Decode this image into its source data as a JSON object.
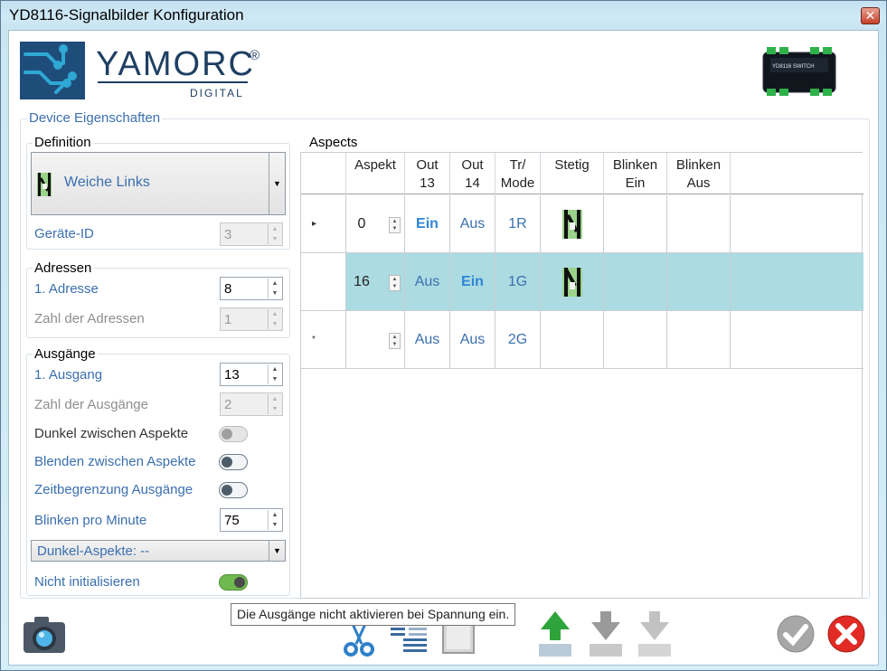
{
  "window": {
    "title": "YD8116-Signalbilder Konfiguration",
    "close_glyph": "✕"
  },
  "logo": {
    "brand": "YAMORC",
    "reg": "®",
    "sub": "DIGITAL",
    "device_label": "YD8116 SWITCH"
  },
  "device_props": {
    "group_label": "Device Eigenschaften",
    "definition": {
      "label": "Definition",
      "selected": "Weiche Links",
      "geraete_id_label": "Geräte-ID",
      "geraete_id_value": "3"
    },
    "adressen": {
      "label": "Adressen",
      "erste_adresse_label": "1. Adresse",
      "erste_adresse_value": "8",
      "zahl_label": "Zahl der Adressen",
      "zahl_value": "1"
    },
    "ausgaenge": {
      "label": "Ausgänge",
      "erster_ausgang_label": "1. Ausgang",
      "erster_ausgang_value": "13",
      "zahl_label": "Zahl der Ausgänge",
      "zahl_value": "2",
      "dunkel_label": "Dunkel zwischen Aspekte",
      "blenden_label": "Blenden zwischen Aspekte",
      "zeit_label": "Zeitbegrenzung Ausgänge",
      "blinken_label": "Blinken pro Minute",
      "blinken_value": "75",
      "dunkel_aspekte_selected": "Dunkel-Aspekte: --",
      "nicht_init_label": "Nicht initialisieren"
    }
  },
  "aspects": {
    "label": "Aspects",
    "headers": {
      "aspekt": "Aspekt",
      "out13": "Out\n13",
      "out14": "Out\n14",
      "trmode": "Tr/\nMode",
      "stetig": "Stetig",
      "blinken_ein": "Blinken\nEin",
      "blinken_aus": "Blinken\nAus"
    },
    "rows": [
      {
        "marker": "▸",
        "aspekt": "0",
        "out13": "Ein",
        "out14": "Aus",
        "trmode": "1R",
        "stetig_icon": "turnout-left-icon"
      },
      {
        "marker": "",
        "aspekt": "16",
        "out13": "Aus",
        "out14": "Ein",
        "trmode": "1G",
        "stetig_icon": "turnout-straight-icon"
      },
      {
        "marker": "*",
        "aspekt": "",
        "out13": "Aus",
        "out14": "Aus",
        "trmode": "2G",
        "stetig_icon": ""
      }
    ]
  },
  "tooltip": "Die Ausgänge nicht aktivieren bei Spannung ein.",
  "colors": {
    "accent_text": "#3a6fae",
    "highlight_row": "#acdbe2",
    "toggle_on": "#6fba4f"
  }
}
